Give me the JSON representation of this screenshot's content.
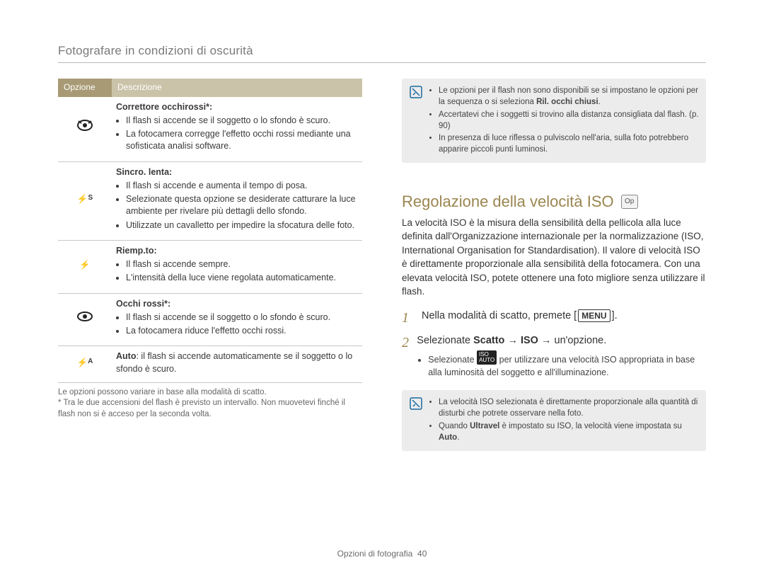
{
  "breadcrumb": "Fotografare in condizioni di oscurità",
  "footer": {
    "section": "Opzioni di fotografia",
    "page": "40"
  },
  "left": {
    "table": {
      "head": {
        "option": "Opzione",
        "desc": "Descrizione"
      },
      "rows": [
        {
          "icon_name": "redeye-fix-icon",
          "title": "Correttore occhirossi*:",
          "bullets": [
            "Il flash si accende se il soggetto o lo sfondo è scuro.",
            "La fotocamera corregge l'effetto occhi rossi mediante una sofisticata analisi software."
          ]
        },
        {
          "icon_name": "slow-sync-icon",
          "title": "Sincro. lenta:",
          "bullets": [
            "Il flash si accende e aumenta il tempo di posa.",
            "Selezionate questa opzione se desiderate catturare la luce ambiente per rivelare più dettagli dello sfondo.",
            "Utilizzate un cavalletto per impedire la sfocatura delle foto."
          ]
        },
        {
          "icon_name": "fill-in-icon",
          "title": "Riemp.to:",
          "bullets": [
            "Il flash si accende sempre.",
            "L'intensità della luce viene regolata automaticamente."
          ]
        },
        {
          "icon_name": "redeye-icon",
          "title": "Occhi rossi*:",
          "bullets": [
            "Il flash si accende se il soggetto o lo sfondo è scuro.",
            "La fotocamera riduce l'effetto occhi rossi."
          ]
        },
        {
          "icon_name": "auto-flash-icon",
          "auto_label": "Auto",
          "auto_text": ": il flash si accende automaticamente se il soggetto o lo sfondo è scuro."
        }
      ]
    },
    "footnote1": "Le opzioni possono variare in base alla modalità di scatto.",
    "footnote2": "* Tra le due accensioni del flash è previsto un intervallo. Non muovetevi finché il flash non si è acceso per la seconda volta."
  },
  "right": {
    "tip1": {
      "bullets": [
        {
          "pre": "Le opzioni per il flash non sono disponibili se si impostano le opzioni per la sequenza o si seleziona ",
          "bold": "Ril. occhi chiusi",
          "post": "."
        },
        {
          "pre": "Accertatevi che i soggetti si trovino alla distanza consigliata dal flash. (p. 90)",
          "bold": "",
          "post": ""
        },
        {
          "pre": "In presenza di luce riflessa o pulviscolo nell'aria, sulla foto potrebbero apparire piccoli punti luminosi.",
          "bold": "",
          "post": ""
        }
      ]
    },
    "heading": "Regolazione della velocità ISO",
    "mode_badge": "Op",
    "intro": "La velocità ISO è la misura della sensibilità della pellicola alla luce definita dall'Organizzazione internazionale per la normalizzazione (ISO, International Organisation for Standardisation). Il valore di velocità ISO è direttamente proporzionale alla sensibilità della fotocamera. Con una elevata velocità ISO, potete ottenere una foto migliore senza utilizzare il flash.",
    "steps": {
      "s1_pre": "Nella modalità di scatto, premete [",
      "s1_chip": "MENU",
      "s1_post": "].",
      "s2_pre": "Selezionate ",
      "s2_bold1": "Scatto",
      "s2_arrow1": " → ",
      "s2_bold2": "ISO",
      "s2_arrow2": " → un'opzione.",
      "s2_sub_pre": "Selezionate ",
      "s2_sub_chip": "ISO\nAUTO",
      "s2_sub_post": " per utilizzare una velocità ISO appropriata in base alla luminosità del soggetto e all'illuminazione."
    },
    "tip2": {
      "bullets": [
        {
          "pre": "La velocità ISO selezionata è direttamente proporzionale alla quantità di disturbi che potrete osservare nella foto.",
          "bold": "",
          "post": ""
        },
        {
          "pre": "Quando ",
          "bold": "Ultravel",
          "post": " è impostato su ISO, la velocità viene impostata su ",
          "bold2": "Auto",
          "post2": "."
        }
      ]
    }
  }
}
